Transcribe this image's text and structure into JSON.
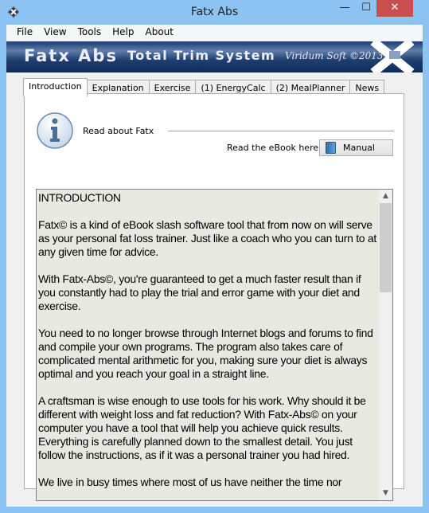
{
  "window": {
    "title": "Fatx Abs",
    "minimize": "—",
    "maximize": "☐",
    "close": "✕",
    "close_color": "#c7504f"
  },
  "menu": [
    "File",
    "View",
    "Tools",
    "Help",
    "About"
  ],
  "banner": {
    "logo": "Fatx Abs",
    "tagline": "Total Trim System",
    "company": "Viridum Soft ©2013"
  },
  "tabs": [
    "Introduction",
    "Explanation",
    "Exercise",
    "(1) EnergyCalc",
    "(2) MealPlanner",
    "News"
  ],
  "intro": {
    "heading": "Read about Fatx",
    "ebook_label": "Read the eBook here:",
    "manual_button": "Manual",
    "paragraphs": [
      "INTRODUCTION",
      "Fatx© is a kind of eBook slash software tool that from now on will serve as your personal fat loss trainer. Just like a coach who you can turn to at any given time for advice.",
      "With Fatx-Abs©, you're guaranteed to get a much faster result than if you constantly had to play the trial and error game with your diet and exercise.",
      "You need to no longer browse through Internet blogs and forums to find and compile your own programs. The program also takes care of complicated mental arithmetic for you, making sure your diet is always optimal and you reach your goal in a straight line.",
      "A craftsman is wise enough to use tools for his work. Why should it be different with weight loss and fat reduction? With Fatx-Abs© on your computer you have a tool that will help you achieve quick results. Everything is carefully planned down to the smallest detail. You just follow the instructions, as if it was a personal trainer you had hired.",
      "We live in busy times where most of us have neither the time nor"
    ]
  }
}
